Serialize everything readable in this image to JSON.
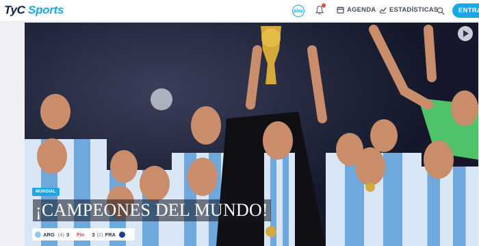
{
  "header": {
    "logo": {
      "main": "TyC",
      "accent": "Sports"
    },
    "play_label": "play",
    "nav": [
      {
        "label": "AGENDA",
        "icon": "calendar-icon"
      },
      {
        "label": "ESTADÍSTICAS",
        "icon": "stats-icon"
      }
    ],
    "enter_label": "ENTRAR"
  },
  "hero": {
    "tag": "MUNDIAL",
    "headline": "¡CAMPEONES DEL MUNDO!",
    "score": {
      "home_team": "ARG",
      "home_goals": "3",
      "home_pens": "(4)",
      "status": "Fin",
      "away_goals": "3",
      "away_pens": "(2)",
      "away_team": "FRA"
    }
  },
  "colors": {
    "accent": "#1aa7e8",
    "notification": "#e8443a",
    "navy": "#0e1e45"
  }
}
